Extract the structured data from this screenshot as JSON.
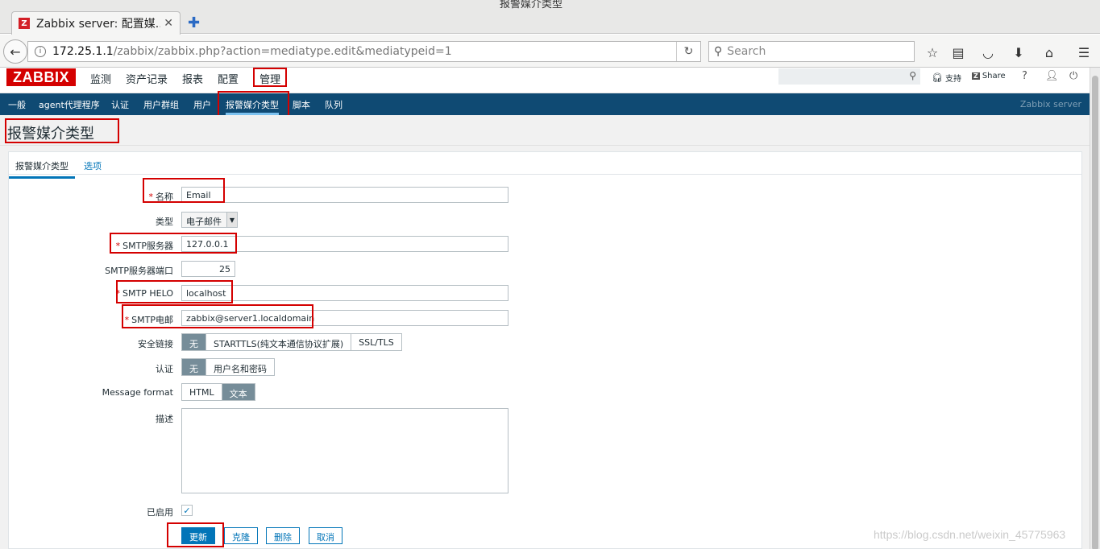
{
  "browser": {
    "window_title": "报警媒介类型",
    "tab_title": "Zabbix server: 配置媒...",
    "tab_favicon": "Z",
    "url_host": "172.25.1.1",
    "url_path": "/zabbix/zabbix.php?action=mediatype.edit&mediatypeid=1",
    "search_placeholder": "Search"
  },
  "header": {
    "logo": "ZABBIX",
    "menu": [
      "监测",
      "资产记录",
      "报表",
      "配置",
      "管理"
    ],
    "support": "支持",
    "share": "Share",
    "help": "?",
    "share_logo": "Z"
  },
  "submenu": {
    "items": [
      "一般",
      "agent代理程序",
      "认证",
      "用户群组",
      "用户",
      "报警媒介类型",
      "脚本",
      "队列"
    ],
    "server": "Zabbix server"
  },
  "page": {
    "title": "报警媒介类型"
  },
  "form": {
    "tabs": [
      "报警媒介类型",
      "选项"
    ],
    "required_mark": "*",
    "name_label": "名称",
    "name_value": "Email",
    "type_label": "类型",
    "type_value": "电子邮件",
    "smtp_server_label": "SMTP服务器",
    "smtp_server_value": "127.0.0.1",
    "smtp_port_label": "SMTP服务器端口",
    "smtp_port_value": "25",
    "smtp_helo_label": "SMTP HELO",
    "smtp_helo_value": "localhost",
    "smtp_email_label": "SMTP电邮",
    "smtp_email_value": "zabbix@server1.localdomain",
    "security_label": "安全链接",
    "security_options": [
      "无",
      "STARTTLS(纯文本通信协议扩展)",
      "SSL/TLS"
    ],
    "auth_label": "认证",
    "auth_options": [
      "无",
      "用户名和密码"
    ],
    "message_format_label": "Message format",
    "message_format_options": [
      "HTML",
      "文本"
    ],
    "description_label": "描述",
    "enabled_label": "已启用",
    "buttons": [
      "更新",
      "克隆",
      "删除",
      "取消"
    ]
  },
  "watermark": "https://blog.csdn.net/weixin_45775963",
  "colors": {
    "accent_red": "#d40000",
    "submenu_bg": "#0f4a73",
    "link_blue": "#0275b8",
    "segment_on": "#768d99"
  }
}
